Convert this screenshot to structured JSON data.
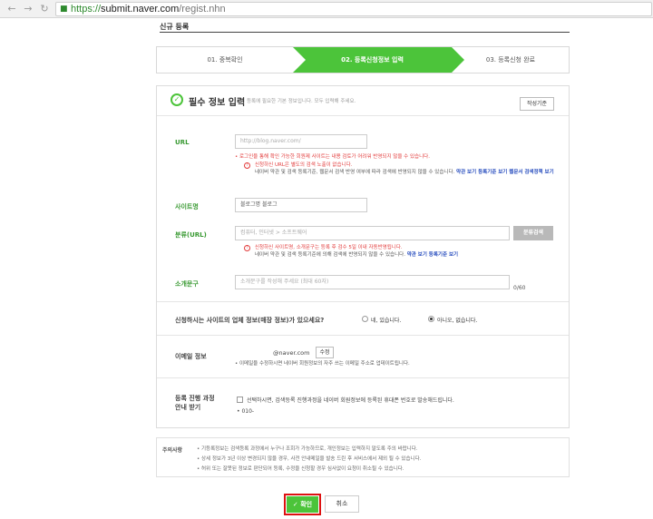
{
  "browser": {
    "url_scheme": "https://",
    "url_host": "submit.naver.com",
    "url_path": "/regist.nhn"
  },
  "page": {
    "title": "신규 등록"
  },
  "steps": [
    {
      "label": "01. 중복확인"
    },
    {
      "label": "02. 등록신청정보 입력"
    },
    {
      "label": "03. 등록신청 완료"
    }
  ],
  "section": {
    "title": "필수 정보 입력",
    "subtitle": "등록에 필요한 기본 정보입니다. 모두 입력해 주세요.",
    "guide_button": "작성기준"
  },
  "url_field": {
    "label": "URL",
    "placeholder": "http://blog.naver.com/",
    "error": "• 로그인을 통해 확인 가능한 회원제 사이트는 내용 검토가 어려워 반영되지 않을 수 있습니다.",
    "note1": "신청하신 URL은 별도의 검색 노출이 없습니다.",
    "note2": "네이버 약관 및 검색 등록기준, 웹문서 검색 반영 여부에 따라 검색에 반영되지 않을 수 있습니다.",
    "note_link": "약관 보기 등록기준 보기 웹문서 검색정책 보기"
  },
  "site_name": {
    "label": "사이트명",
    "value": "블로그명 블로그"
  },
  "category": {
    "label": "분류(URL)",
    "placeholder": "컴퓨터, 인터넷 > 소프트웨어",
    "button": "분류검색",
    "note1": "신청하신 사이트명, 소개문구는 등록 후 검수 5일 이내 자동반영됩니다.",
    "note2": "네이버 약관 및 검색 등록기준에 의해 검색에 반영되지 않을 수 있습니다.",
    "note_link": "약관 보기 등록기준 보기"
  },
  "intro": {
    "label": "소개문구",
    "placeholder": "소개문구를 작성해 주세요 (최대 60자)",
    "counter": "0/60"
  },
  "store_question": {
    "label": "신청하시는 사이트의 업체 정보(매장 정보)가 있으세요?",
    "yes": "네, 있습니다.",
    "no": "아니오, 없습니다."
  },
  "email": {
    "label": "이메일 정보",
    "domain": "@naver.com",
    "edit_button": "수정",
    "note": "• 이메일을 수정하시면 네이버 회원정보의 자주 쓰는 이메일 주소로 업데이트됩니다."
  },
  "sms": {
    "label_line1": "등록 진행 과정",
    "label_line2": "안내 받기",
    "checkbox_text": "선택하시면, 검색등록 진행과정을 네이버 회원정보에 등록된 휴대폰 번호로 발송해드립니다.",
    "phone": "• 010-"
  },
  "caution": {
    "title": "주의사항",
    "lines": [
      "• 기등록정보는 검색등록 과정에서 누구나 조회가 가능하므로, 개인정보는 입력하지 말도록 주의 바랍니다.",
      "• 상세 정보가 3년 이상 변경되지 않을 경우, 사전 안내메일을 발송 드린 후 서비스에서 제외 될 수 있습니다.",
      "• 허위 또는 잘못된 정보로 판단되어 등록, 수정을 신청할 경우 심사없이 요청이 취소될 수 있습니다."
    ]
  },
  "actions": {
    "confirm": "확인",
    "cancel": "취소"
  }
}
